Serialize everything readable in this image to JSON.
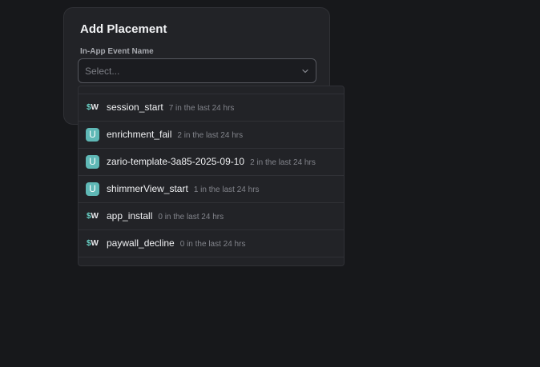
{
  "card": {
    "title": "Add Placement",
    "field_label": "In-App Event Name",
    "select_placeholder": "Select..."
  },
  "dropdown": {
    "options": [
      {
        "icon": "$W",
        "icon_name": "superwall-icon",
        "name": "session_start",
        "meta": "7 in the last 24 hrs"
      },
      {
        "icon": "U",
        "icon_name": "user-event-icon",
        "name": "enrichment_fail",
        "meta": "2 in the last 24 hrs"
      },
      {
        "icon": "U",
        "icon_name": "user-event-icon",
        "name": "zario-template-3a85-2025-09-10",
        "meta": "2 in the last 24 hrs"
      },
      {
        "icon": "U",
        "icon_name": "user-event-icon",
        "name": "shimmerView_start",
        "meta": "1 in the last 24 hrs"
      },
      {
        "icon": "$W",
        "icon_name": "superwall-icon",
        "name": "app_install",
        "meta": "0 in the last 24 hrs"
      },
      {
        "icon": "$W",
        "icon_name": "superwall-icon",
        "name": "paywall_decline",
        "meta": "0 in the last 24 hrs"
      }
    ]
  },
  "colors": {
    "background": "#17181b",
    "panel": "#222327",
    "accent_teal": "#5fb8b6"
  }
}
